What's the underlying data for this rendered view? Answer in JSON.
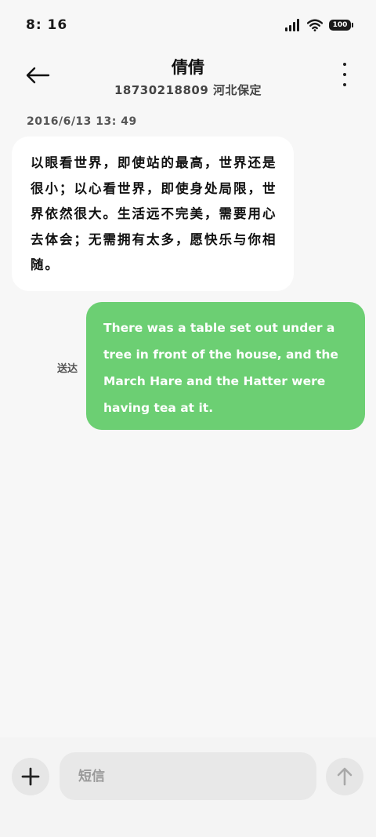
{
  "status_bar": {
    "time": "8: 16",
    "battery_level": "100",
    "icons": [
      "signal-icon",
      "wifi-icon",
      "battery-icon"
    ]
  },
  "header": {
    "contact_name": "倩倩",
    "contact_subtitle": "18730218809 河北保定",
    "back_icon": "arrow-left-icon",
    "more_icon": "more-vertical-icon"
  },
  "conversation": {
    "timestamp": "2016/6/13 13: 49",
    "messages": [
      {
        "direction": "incoming",
        "text": "以眼看世界，即使站的最高，世界还是很小；以心看世界，即使身处局限，世界依然很大。生活远不完美，需要用心去体会；无需拥有太多，愿快乐与你相随。"
      },
      {
        "direction": "outgoing",
        "status": "送达",
        "text": "There was a table set out under a tree in front of the house, and the March Hare and the Hatter were having tea at it."
      }
    ]
  },
  "composer": {
    "placeholder": "短信",
    "value": "",
    "add_icon": "plus-icon",
    "send_icon": "arrow-up-icon"
  },
  "colors": {
    "background": "#f7f7f7",
    "incoming_bubble": "#ffffff",
    "outgoing_bubble": "#6ccf73",
    "input_background": "#e8e8e8"
  }
}
